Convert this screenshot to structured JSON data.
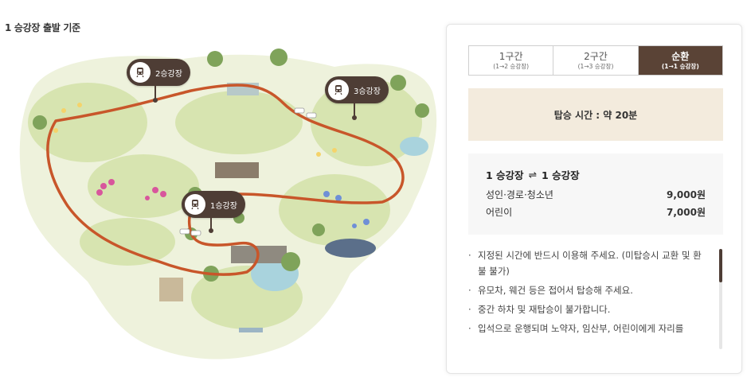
{
  "heading": "1 승강장 출발 기준",
  "map": {
    "stations": [
      {
        "label": "2승강장",
        "icon": "train-icon"
      },
      {
        "label": "3승강장",
        "icon": "train-icon"
      },
      {
        "label": "1승강장",
        "icon": "train-icon"
      }
    ],
    "colors": {
      "route": "#c8562a",
      "grass": "#d7e4b0",
      "ground": "#eef2dc",
      "tag": "#4e3d35"
    }
  },
  "tabs": [
    {
      "title": "1구간",
      "sub": "(1→2 승강장)",
      "active": false
    },
    {
      "title": "2구간",
      "sub": "(1→3 승강장)",
      "active": false
    },
    {
      "title": "순환",
      "sub": "(1→1 승강장)",
      "active": true
    }
  ],
  "ride_time": "탑승 시간 : 약 20분",
  "fare": {
    "from": "1 승강장",
    "swap_symbol": "⇌",
    "to": "1 승강장",
    "rows": [
      {
        "label": "성인·경로·청소년",
        "price": "9,000원"
      },
      {
        "label": "어린이",
        "price": "7,000원"
      }
    ]
  },
  "notices": [
    {
      "bullet": "·",
      "text": "지정된 시간에 반드시 이용해 주세요. (미탑승시 교환 및 환불 불가)"
    },
    {
      "bullet": "·",
      "text": "유모차, 웨건 등은 접어서 탑승해 주세요."
    },
    {
      "bullet": "·",
      "text": "중간 하차 및 재탑승이 불가합니다."
    },
    {
      "bullet": "·",
      "text": "입석으로 운행되며 노약자, 임산부, 어린이에게 자리를"
    }
  ],
  "accent_color": "#5a4336",
  "ride_time_bg": "#f3ebdd"
}
